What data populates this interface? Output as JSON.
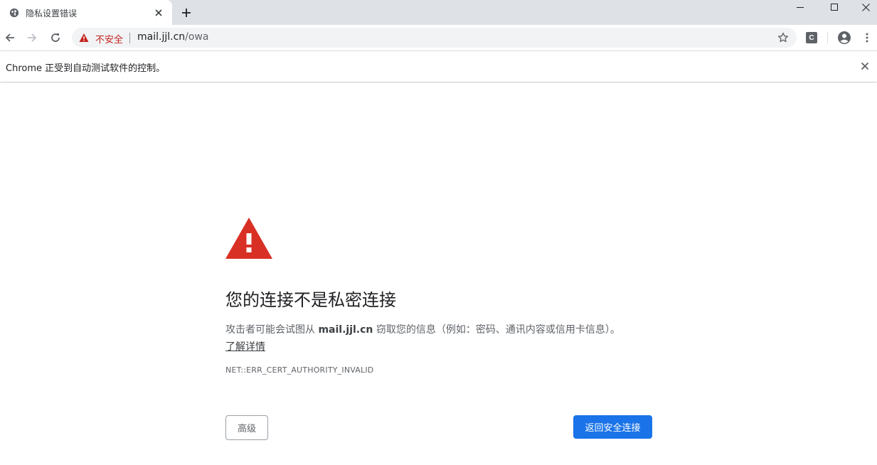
{
  "tab": {
    "title": "隐私设置错误",
    "favicon": "globe-icon"
  },
  "toolbar": {
    "security_label": "不安全",
    "url_host": "mail.jjl.cn",
    "url_path": "/owa",
    "extension_label": "C"
  },
  "infobar": {
    "text": "Chrome 正受到自动测试软件的控制。"
  },
  "interstitial": {
    "heading": "您的连接不是私密连接",
    "message_before": "攻击者可能会试图从 ",
    "message_host": "mail.jjl.cn",
    "message_after": " 窃取您的信息（例如：密码、通讯内容或信用卡信息）。",
    "learn_more": "了解详情",
    "error_code": "NET::ERR_CERT_AUTHORITY_INVALID",
    "advanced_button": "高级",
    "back_button": "返回安全连接"
  },
  "colors": {
    "warning_red": "#d93025",
    "primary_blue": "#1a73e8",
    "tabstrip_bg": "#dee1e6",
    "omnibox_bg": "#f1f3f4"
  }
}
